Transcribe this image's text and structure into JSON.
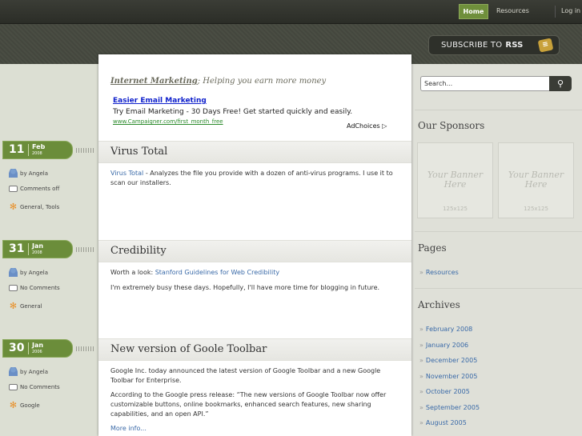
{
  "nav": {
    "home": "Home",
    "resources": "Resources",
    "login": "Log in"
  },
  "rss": {
    "prefix": "SUBSCRIBE TO",
    "strong": "RSS",
    "icon": "rss-icon"
  },
  "tagline": {
    "link": "Internet Marketing",
    "text": "; Helping you earn more money"
  },
  "ad": {
    "title": "Easier Email Marketing",
    "text": "Try Email Marketing - 30 Days Free! Get started quickly and easily.",
    "url": "www.Campaigner.com/first_month_free",
    "choices": "AdChoices"
  },
  "posts": [
    {
      "day": "11",
      "month": "Feb",
      "year": "2008",
      "title": "Virus Total",
      "author": "by Angela",
      "comments": "Comments off",
      "tags": "General, Tools",
      "link": "Virus Total",
      "body": " - Analyzes the file you provide with a dozen of anti-virus programs. I use it to scan our installers."
    },
    {
      "day": "31",
      "month": "Jan",
      "year": "2008",
      "title": "Credibility",
      "author": "by Angela",
      "comments": "No Comments",
      "tags": "General",
      "lead": "Worth a look: ",
      "link": "Stanford Guidelines for Web Credibility",
      "body2": "I'm extremely busy these days. Hopefully, I'll have more time for blogging in future."
    },
    {
      "day": "30",
      "month": "Jan",
      "year": "2006",
      "title": "New version of Goole Toolbar",
      "author": "by Angela",
      "comments": "No Comments",
      "tags": "Google",
      "p1": "Google Inc. today announced the latest version of Google Toolbar and a new Google Toolbar for Enterprise.",
      "p2": "According to the Google press release: “The new versions of Google Toolbar now offer customizable buttons, online bookmarks, enhanced search features, new sharing capabilities, and an open API.”",
      "more": "More info..."
    }
  ],
  "sidebar": {
    "search_placeholder": "Search...",
    "sponsors_title": "Our Sponsors",
    "banner_text_1": "Your Banner",
    "banner_text_2": "Here",
    "banner_size": "125x125",
    "pages_title": "Pages",
    "pages": [
      "Resources"
    ],
    "archives_title": "Archives",
    "archives": [
      "February 2008",
      "January 2006",
      "December 2005",
      "November 2005",
      "October 2005",
      "September 2005",
      "August 2005"
    ]
  },
  "colors": {
    "accent": "#6b8d3a",
    "link": "#3a6aa8"
  }
}
